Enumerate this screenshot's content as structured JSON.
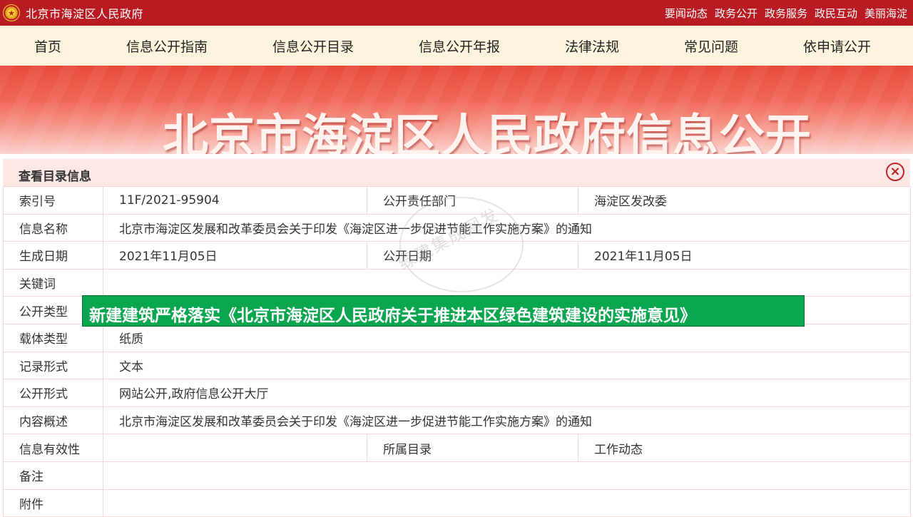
{
  "topbar": {
    "site_name": "北京市海淀区人民政府",
    "links": [
      "要闻动态",
      "政务公开",
      "政务服务",
      "政民互动",
      "美丽海淀"
    ]
  },
  "nav": {
    "items": [
      "首页",
      "信息公开指南",
      "信息公开目录",
      "信息公开年报",
      "法律法规",
      "常见问题",
      "依申请公开"
    ]
  },
  "banner": {
    "title": "北京市海淀区人民政府信息公开"
  },
  "panel": {
    "title": "查看目录信息",
    "close_icon": "×",
    "rows": [
      {
        "label": "索引号",
        "value": "11F/2021-95904",
        "label2": "公开责任部门",
        "value2": "海淀区发改委"
      },
      {
        "label": "信息名称",
        "value": "北京市海淀区发展和改革委员会关于印发《海淀区进一步促进节能工作实施方案》的通知"
      },
      {
        "label": "生成日期",
        "value": "2021年11月05日",
        "label2": "公开日期",
        "value2": "2021年11月05日"
      },
      {
        "label": "关键词",
        "value": ""
      },
      {
        "label": "公开类型",
        "value": ""
      },
      {
        "label": "载体类型",
        "value": "纸质"
      },
      {
        "label": "记录形式",
        "value": "文本"
      },
      {
        "label": "公开形式",
        "value": "网站公开,政府信息公开大厅"
      },
      {
        "label": "内容概述",
        "value": "北京市海淀区发展和改革委员会关于印发《海淀区进一步促进节能工作实施方案》的通知"
      },
      {
        "label": "信息有效性",
        "value": "",
        "label2": "所属目录",
        "value2": "工作动态"
      },
      {
        "label": "备注",
        "value": ""
      },
      {
        "label": "附件",
        "value": ""
      }
    ]
  },
  "watermark": {
    "text": "绿建集成网发"
  },
  "caption": {
    "text": "新建建筑严格落实《北京市海淀区人民政府关于推进本区绿色建筑建设的实施意见》"
  },
  "colors": {
    "brand_red": "#b81c22",
    "nav_bg": "#fdf4dd",
    "caption_green": "#0aa64f"
  }
}
